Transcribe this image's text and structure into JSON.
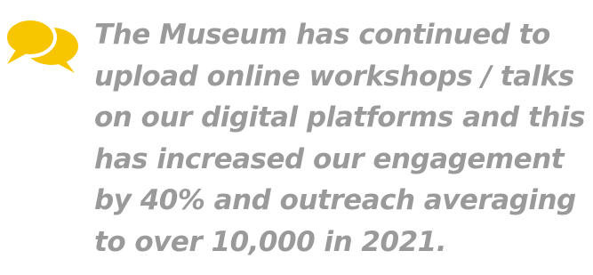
{
  "quote": {
    "lines": [
      "The Museum has continued to",
      "upload online workshops / talks",
      "on our digital platforms and this",
      "has increased our engagement",
      "by 40% and outreach averaging",
      "to over 10,000 in 2021."
    ]
  },
  "icon": {
    "name": "speech-bubbles-icon",
    "color": "#F7C600"
  },
  "colors": {
    "text": "#9a9a9a",
    "icon": "#F7C600",
    "background": "#ffffff"
  }
}
